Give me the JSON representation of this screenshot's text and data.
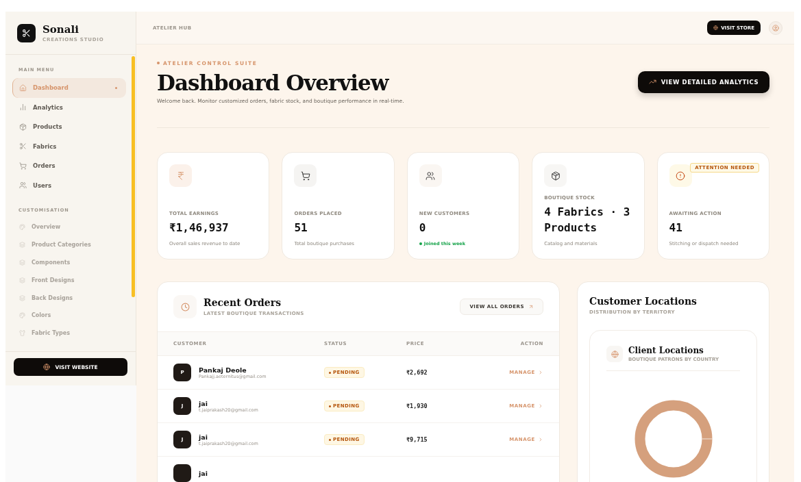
{
  "brand": {
    "name": "Sonali",
    "tagline": "CREATIONS STUDIO"
  },
  "sidebar": {
    "sections": [
      {
        "title": "MAIN MENU",
        "muted": false,
        "items": [
          {
            "label": "Dashboard",
            "selected": true
          },
          {
            "label": "Analytics",
            "selected": false
          },
          {
            "label": "Products",
            "selected": false
          },
          {
            "label": "Fabrics",
            "selected": false
          },
          {
            "label": "Orders",
            "selected": false
          },
          {
            "label": "Users",
            "selected": false
          }
        ]
      },
      {
        "title": "CUSTOMISATION",
        "muted": true,
        "items": [
          {
            "label": "Overview",
            "selected": false
          },
          {
            "label": "Product Categories",
            "selected": false
          },
          {
            "label": "Components",
            "selected": false
          },
          {
            "label": "Front Designs",
            "selected": false
          },
          {
            "label": "Back Designs",
            "selected": false
          },
          {
            "label": "Colors",
            "selected": false
          },
          {
            "label": "Fabric Types",
            "selected": false
          }
        ]
      }
    ],
    "footer_button": "VISIT WEBSITE"
  },
  "topbar": {
    "breadcrumb": "ATELIER HUB",
    "store_button": "VISIT STORE"
  },
  "header": {
    "eyebrow": "ATELIER CONTROL SUITE",
    "title": "Dashboard Overview",
    "subtitle": "Welcome back. Monitor customized orders, fabric stock, and boutique performance in real-time.",
    "button": "VIEW DETAILED ANALYTICS"
  },
  "stats": [
    {
      "label": "TOTAL EARNINGS",
      "value": "₹1,46,937",
      "note": "Overall sales revenue to date",
      "kind": "plain"
    },
    {
      "label": "ORDERS PLACED",
      "value": "51",
      "note": "Total boutique purchases",
      "kind": "plain"
    },
    {
      "label": "NEW CUSTOMERS",
      "value": "0",
      "note": "Joined this week",
      "kind": "positive"
    },
    {
      "label": "BOUTIQUE STOCK",
      "value": "4 Fabrics · 3 Products",
      "note": "Catalog and materials",
      "kind": "plain"
    },
    {
      "label": "AWAITING ACTION",
      "value": "41",
      "note": "Stitching or dispatch needed",
      "kind": "plain",
      "badge": "ATTENTION NEEDED"
    }
  ],
  "orders": {
    "title": "Recent Orders",
    "subtitle": "LATEST BOUTIQUE TRANSACTIONS",
    "button": "VIEW ALL ORDERS",
    "columns": [
      "CUSTOMER",
      "STATUS",
      "PRICE",
      "ACTION"
    ],
    "rows": [
      {
        "initial": "P",
        "name": "Pankaj Deole",
        "email": "Pankajj.aeternitus@gmail.com",
        "status": "PENDING",
        "price": "₹2,692",
        "action": "MANAGE"
      },
      {
        "initial": "J",
        "name": "jai",
        "email": "t.jaiprakash20@gmail.com",
        "status": "PENDING",
        "price": "₹1,930",
        "action": "MANAGE"
      },
      {
        "initial": "J",
        "name": "jai",
        "email": "t.jaiprakash20@gmail.com",
        "status": "PENDING",
        "price": "₹9,715",
        "action": "MANAGE"
      },
      {
        "name": "jai"
      }
    ]
  },
  "locations": {
    "title": "Customer Locations",
    "subtitle": "DISTRIBUTION BY TERRITORY",
    "inner_title": "Client Locations",
    "inner_subtitle": "BOUTIQUE PATRONS BY COUNTRY"
  }
}
